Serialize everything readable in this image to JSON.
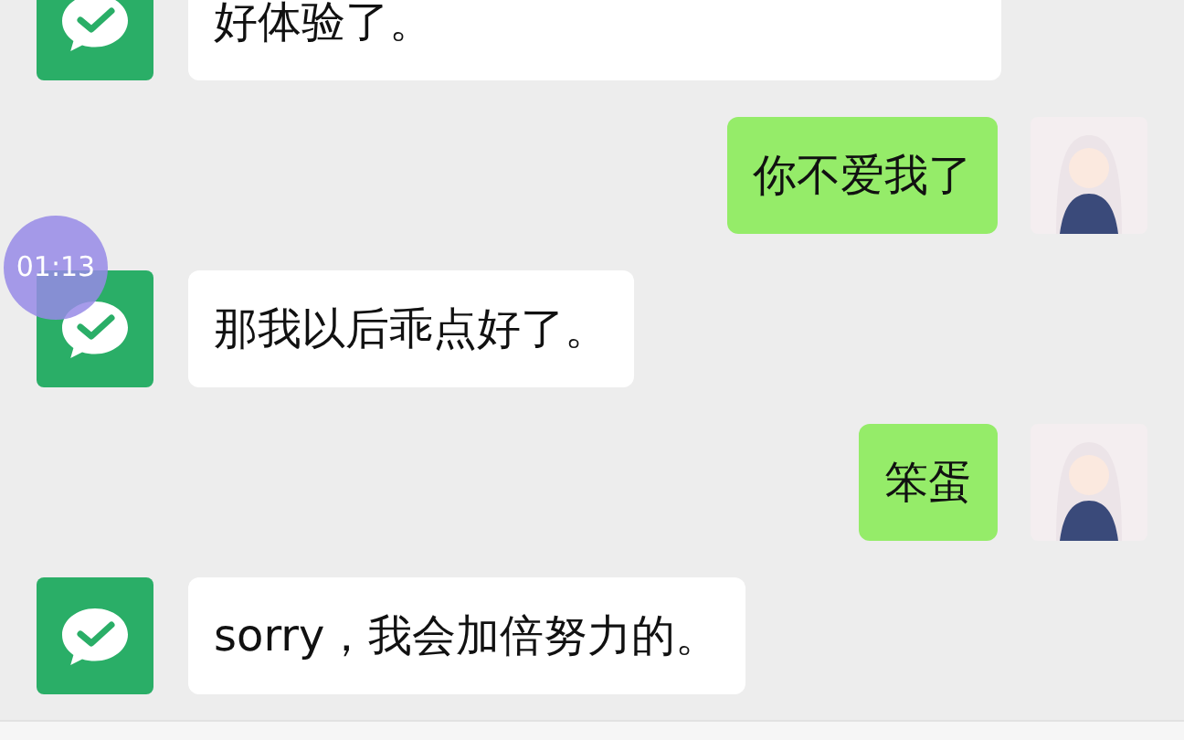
{
  "messages": [
    {
      "kind": "received",
      "text": "好体验了。",
      "partial": true
    },
    {
      "kind": "sent",
      "text": "你不爱我了",
      "partial": false
    },
    {
      "kind": "received",
      "text": "那我以后乖点好了。",
      "partial": false
    },
    {
      "kind": "sent",
      "text": "笨蛋",
      "partial": false
    },
    {
      "kind": "received",
      "text": "sorry，我会加倍努力的。",
      "partial": false
    }
  ],
  "overlay": {
    "time": "01:13"
  }
}
